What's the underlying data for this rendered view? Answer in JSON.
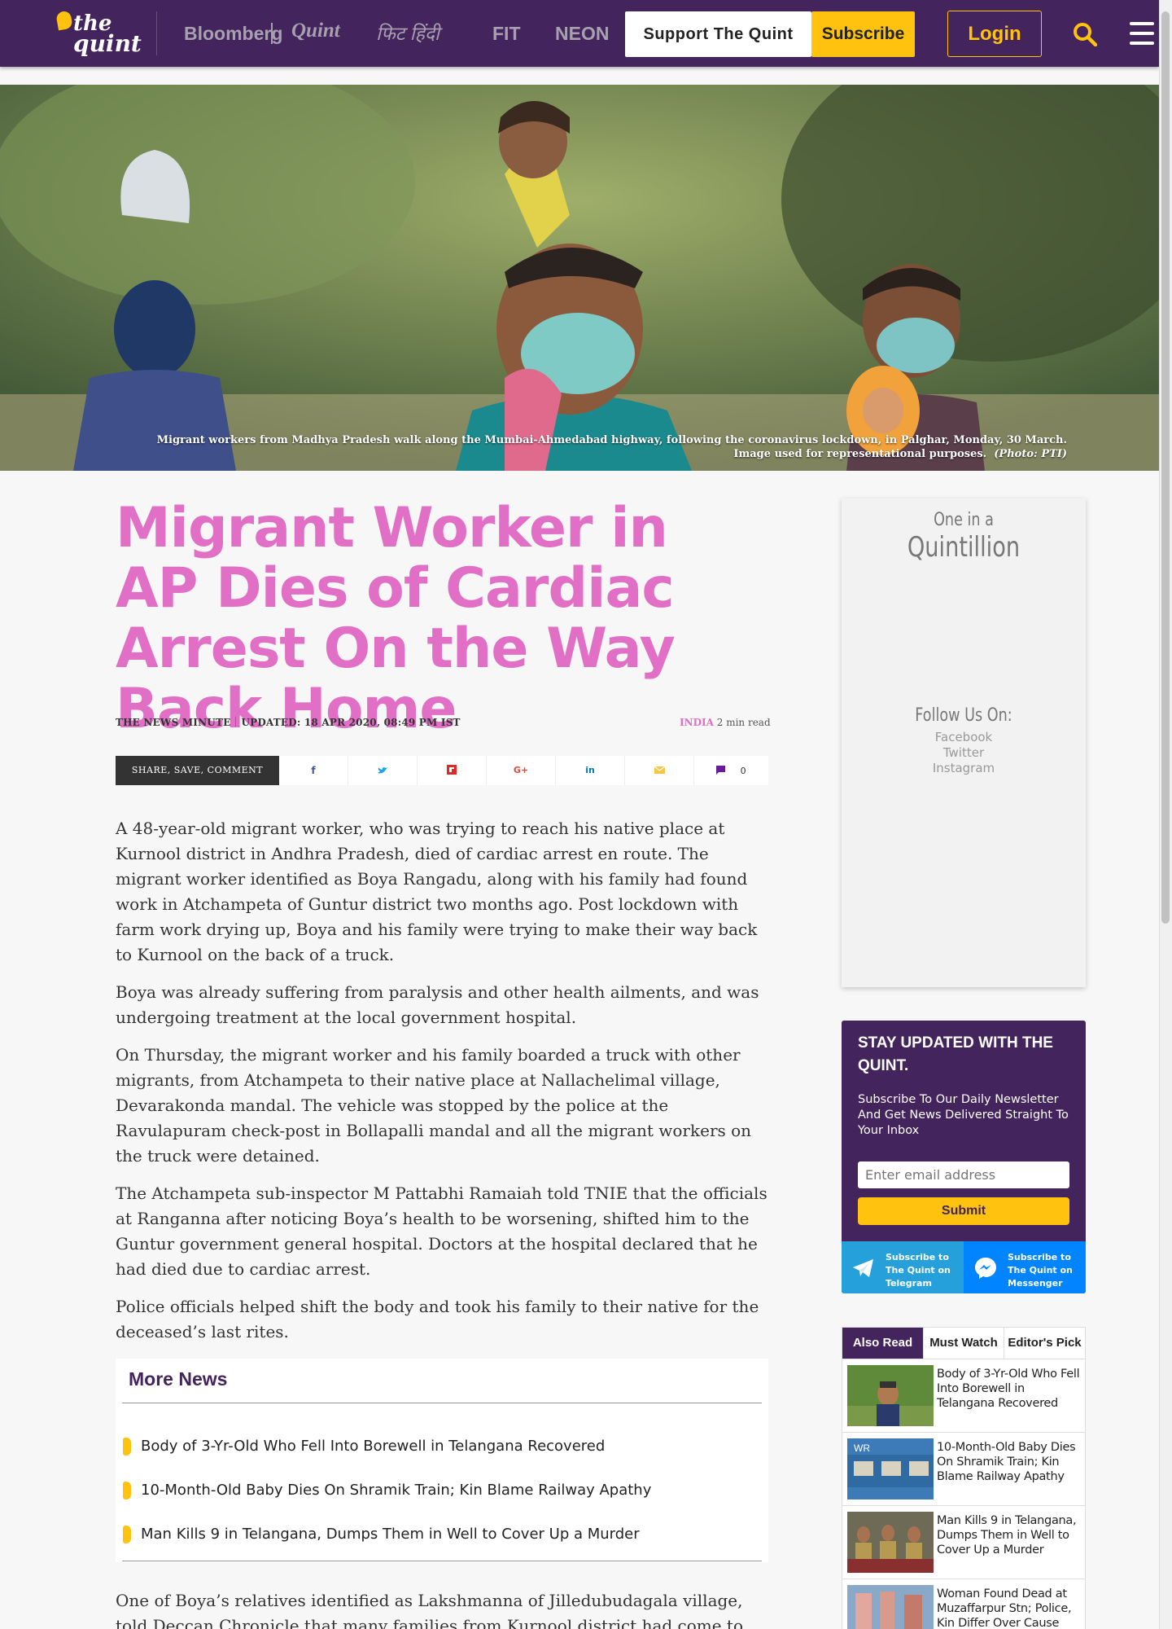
{
  "header": {
    "logo_line1": "the",
    "logo_line2": "quint",
    "nav": [
      "Bloomberg",
      "Quint",
      "फिट हिंदी",
      "FIT",
      "NEON"
    ],
    "support_label": "Support The Quint",
    "subscribe_label": "Subscribe",
    "login_label": "Login",
    "colors": {
      "brand_purple": "#43245d",
      "accent_yellow": "#ffc20e"
    }
  },
  "hero": {
    "caption_line1": "Migrant workers from Madhya Pradesh walk along the Mumbai-Ahmedabad highway, following the coronavirus lockdown, in Palghar, Monday, 30 March.",
    "caption_line2": "Image used for representational purposes.",
    "caption_credit": "(Photo: PTI)"
  },
  "article": {
    "title": "Migrant Worker in AP Dies of Cardiac Arrest On the Way Back Home",
    "source": "THE NEWS MINUTE",
    "updated": "UPDATED: 18 APR 2020, 08:49 PM IST",
    "category": "INDIA",
    "read_time": "2 min read",
    "share_label": "SHARE, SAVE, COMMENT",
    "comment_count": "0",
    "paragraphs": [
      "A 48-year-old migrant worker, who was trying to reach his native place at Kurnool district in Andhra Pradesh, died of cardiac arrest en route. The migrant worker identified as Boya Rangadu, along with his family had found work in Atchampeta of Guntur district two months ago. Post lockdown with farm work drying up, Boya and his family were trying to make their way back to Kurnool on the back of a truck.",
      "Boya was already suffering from paralysis and other health ailments, and was undergoing treatment at the local government hospital.",
      "On Thursday, the migrant worker and his family boarded a truck with other migrants, from Atchampeta to their native place at Nallachelimal village, Devarakonda mandal. The vehicle was stopped by the police at the Ravulapuram check-post in Bollapalli mandal and all the migrant workers on the truck were detained.",
      "The Atchampeta sub-inspector M Pattabhi Ramaiah told TNIE that the officials at Ranganna after noticing Boya’s health to be worsening, shifted him to the Guntur government general hospital. Doctors at the hospital declared that he had died due to cardiac arrest.",
      "Police officials helped shift the body and took his family to their native for the deceased’s last rites."
    ],
    "more_news_title": "More News",
    "more_news": [
      "Body of 3-Yr-Old Who Fell Into Borewell in Telangana Recovered",
      "10-Month-Old Baby Dies On Shramik Train; Kin Blame Railway Apathy",
      "Man Kills 9 in Telangana, Dumps Them in Well to Cover Up a Murder"
    ],
    "after_paragraph": "One of Boya’s relatives identified as Lakshmanna of Jilledubudagala village, told Deccan Chronicle that many families from Kurnool district had come to Guntur"
  },
  "sidebar": {
    "ad": {
      "top": "One in a",
      "big": "Quintillion",
      "follow": "Follow Us On:",
      "links": [
        "Facebook",
        "Twitter",
        "Instagram"
      ]
    },
    "newsletter": {
      "title": "STAY UPDATED WITH THE QUINT.",
      "subtitle": "Subscribe To Our Daily Newsletter And Get News Delivered Straight To Your Inbox",
      "email_placeholder": "Enter email address",
      "submit_label": "Submit",
      "telegram_label": "Subscribe to The Quint on Telegram",
      "messenger_label": "Subscribe to The Quint on Messenger"
    },
    "tabs": [
      "Also Read",
      "Must Watch",
      "Editor's Pick"
    ],
    "related": [
      "Body of 3-Yr-Old Who Fell Into Borewell in Telangana Recovered",
      "10-Month-Old Baby Dies On Shramik Train; Kin Blame Railway Apathy",
      "Man Kills 9 in Telangana, Dumps Them in Well to Cover Up a Murder",
      "Woman Found Dead at Muzaffarpur Stn; Police, Kin Differ Over Cause"
    ]
  }
}
